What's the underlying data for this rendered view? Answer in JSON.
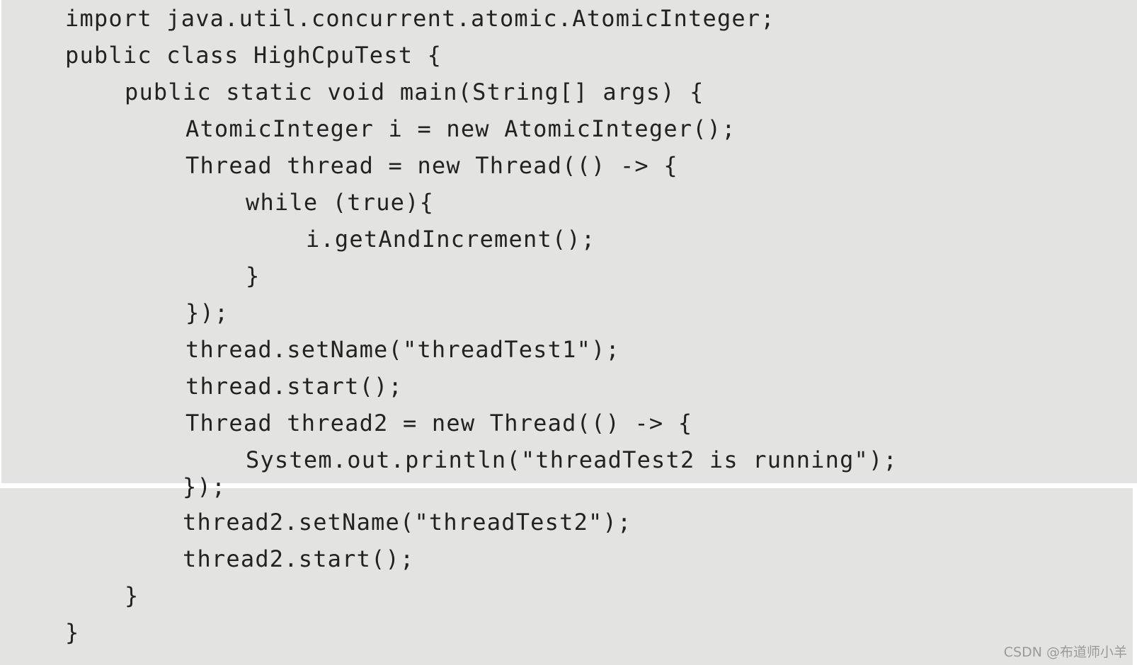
{
  "code": {
    "lines": [
      "import java.util.concurrent.atomic.AtomicInteger;",
      "public class HighCpuTest {",
      "public static void main(String[] args) {",
      "AtomicInteger i = new AtomicInteger();",
      "Thread thread = new Thread(() -> {",
      "while (true){",
      "i.getAndIncrement();",
      "}",
      "});",
      "thread.setName(\"threadTest1\");",
      "thread.start();",
      "Thread thread2 = new Thread(() -> {",
      "System.out.println(\"threadTest2 is running\");",
      "});",
      "thread2.setName(\"threadTest2\");",
      "thread2.start();",
      "}",
      "}"
    ]
  },
  "watermark": {
    "text": "CSDN @布道师小羊"
  }
}
